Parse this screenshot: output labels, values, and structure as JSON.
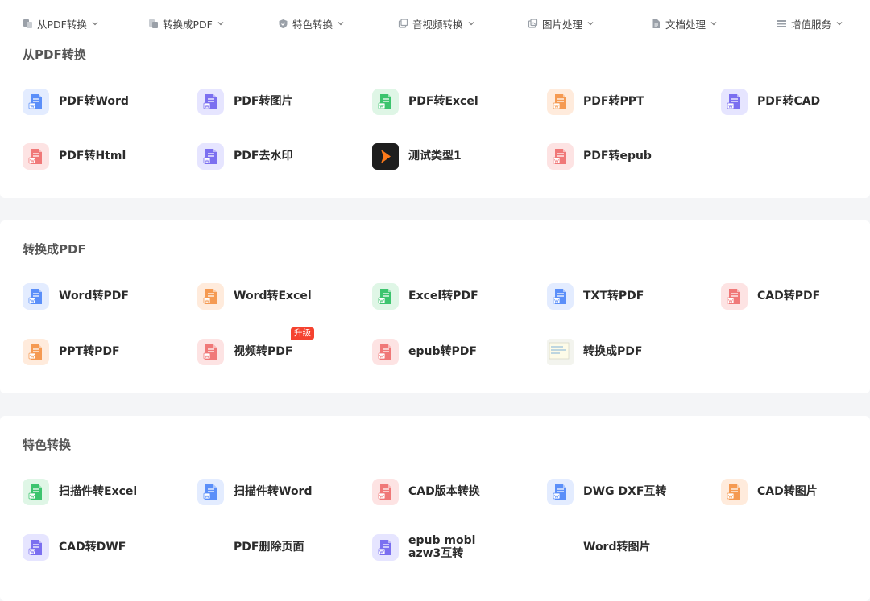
{
  "nav": [
    {
      "label": "从PDF转换",
      "icon": "pdf-convert-icon"
    },
    {
      "label": "转换成PDF",
      "icon": "to-pdf-icon"
    },
    {
      "label": "特色转换",
      "icon": "shield-icon"
    },
    {
      "label": "音视频转换",
      "icon": "media-icon"
    },
    {
      "label": "图片处理",
      "icon": "image-icon"
    },
    {
      "label": "文档处理",
      "icon": "document-icon"
    },
    {
      "label": "增值服务",
      "icon": "list-icon"
    }
  ],
  "colors": {
    "blue_bg": "#e3ecff",
    "blue": "#5b8ff9",
    "purple_bg": "#e6e5ff",
    "purple": "#7b6ff0",
    "green_bg": "#dff6e6",
    "green": "#3cc46e",
    "orange_bg": "#ffebdc",
    "orange": "#f59a52",
    "red_bg": "#fde3e3",
    "red": "#f07878",
    "badge": "#f5422f"
  },
  "sections": [
    {
      "title": "从PDF转换",
      "items": [
        {
          "label": "PDF转Word",
          "icon": "word-file-icon",
          "color": "blue"
        },
        {
          "label": "PDF转图片",
          "icon": "image-file-icon",
          "color": "purple"
        },
        {
          "label": "PDF转Excel",
          "icon": "excel-file-icon",
          "color": "green"
        },
        {
          "label": "PDF转PPT",
          "icon": "ppt-file-icon",
          "color": "orange"
        },
        {
          "label": "PDF转CAD",
          "icon": "cad-file-icon",
          "color": "purple"
        },
        {
          "label": "PDF转Html",
          "icon": "html-file-icon",
          "color": "red"
        },
        {
          "label": "PDF去水印",
          "icon": "watermark-file-icon",
          "color": "purple"
        },
        {
          "label": "测试类型1",
          "icon": "play-logo-icon",
          "color": "dark"
        },
        {
          "label": "PDF转epub",
          "icon": "epub-file-icon",
          "color": "red"
        }
      ]
    },
    {
      "title": "转换成PDF",
      "items": [
        {
          "label": "Word转PDF",
          "icon": "word-file-icon",
          "color": "blue"
        },
        {
          "label": "Word转Excel",
          "icon": "excel-file-icon",
          "color": "orange"
        },
        {
          "label": "Excel转PDF",
          "icon": "excel-file-icon",
          "color": "green"
        },
        {
          "label": "TXT转PDF",
          "icon": "txt-file-icon",
          "color": "blue"
        },
        {
          "label": "CAD转PDF",
          "icon": "cad-file-icon",
          "color": "red"
        },
        {
          "label": "PPT转PDF",
          "icon": "ppt-file-icon",
          "color": "orange"
        },
        {
          "label": "视频转PDF",
          "icon": "video-file-icon",
          "color": "red",
          "badge": "升级"
        },
        {
          "label": "epub转PDF",
          "icon": "epub-file-icon",
          "color": "red"
        },
        {
          "label": "转换成PDF",
          "icon": "note-thumbnail-icon",
          "color": "note"
        }
      ]
    },
    {
      "title": "特色转换",
      "items": [
        {
          "label": "扫描件转Excel",
          "icon": "scan-excel-icon",
          "color": "green"
        },
        {
          "label": "扫描件转Word",
          "icon": "scan-word-icon",
          "color": "blue"
        },
        {
          "label": "CAD版本转换",
          "icon": "cad-version-icon",
          "color": "red"
        },
        {
          "label": "DWG DXF互转",
          "icon": "dwg-file-icon",
          "color": "blue"
        },
        {
          "label": "CAD转图片",
          "icon": "cad-image-icon",
          "color": "orange"
        },
        {
          "label": "CAD转DWF",
          "icon": "dwf-file-icon",
          "color": "purple"
        },
        {
          "label": "PDF删除页面",
          "icon": "",
          "color": "none"
        },
        {
          "label": "epub mobi azw3互转",
          "icon": "ebook-file-icon",
          "color": "purple"
        },
        {
          "label": "Word转图片",
          "icon": "",
          "color": "none"
        }
      ]
    }
  ]
}
